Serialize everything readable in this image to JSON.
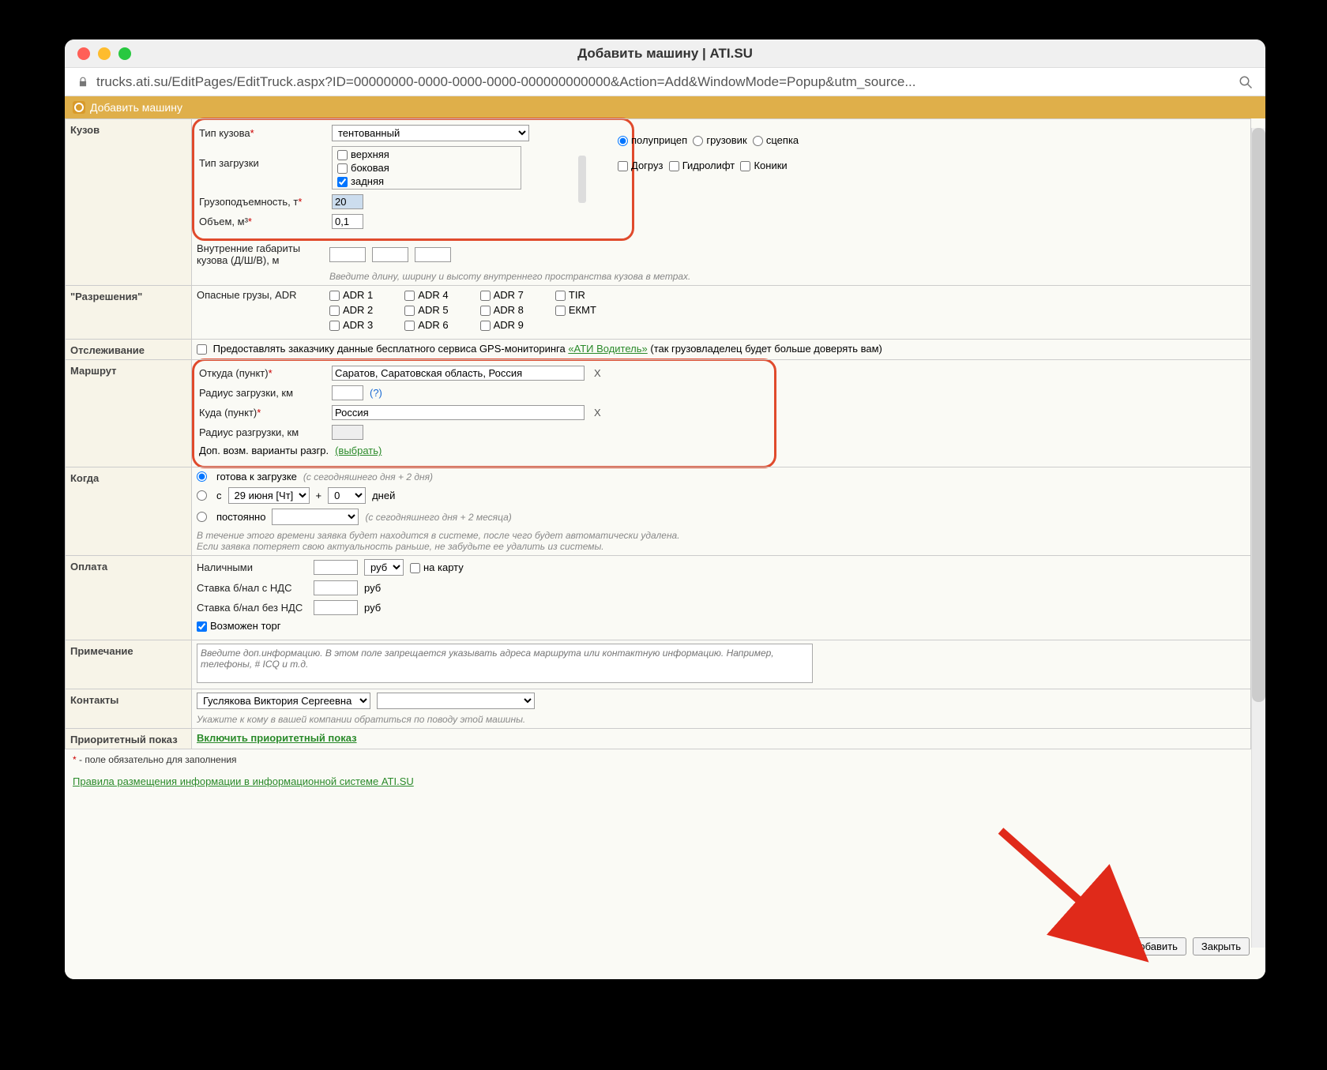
{
  "window": {
    "title": "Добавить машину | ATI.SU",
    "url": "trucks.ati.su/EditPages/EditTruck.aspx?ID=00000000-0000-0000-0000-000000000000&Action=Add&WindowMode=Popup&utm_source..."
  },
  "header": {
    "title": "Добавить машину"
  },
  "sections": {
    "body_label": "Кузов",
    "body_type_label": "Тип кузова",
    "body_type_value": "тентованный",
    "trailer_options": {
      "semi": "полуприцеп",
      "truck": "грузовик",
      "hitch": "сцепка"
    },
    "loading_label": "Тип загрузки",
    "loading_options": {
      "top": "верхняя",
      "side": "боковая",
      "rear": "задняя"
    },
    "extra_options": {
      "dogruz": "Догруз",
      "hydro": "Гидролифт",
      "koniki": "Коники"
    },
    "capacity_label": "Грузоподъемность, т",
    "capacity_value": "20",
    "volume_label": "Объем, м³",
    "volume_value": "0,1",
    "dims_label": "Внутренние габариты кузова (Д/Ш/В), м",
    "dims_hint": "Введите длину, ширину и высоту внутреннего пространства кузова в метрах.",
    "permits_label": "\"Разрешения\"",
    "adr_label": "Опасные грузы, ADR",
    "adr": [
      "ADR 1",
      "ADR 2",
      "ADR 3",
      "ADR 4",
      "ADR 5",
      "ADR 6",
      "ADR 7",
      "ADR 8",
      "ADR 9"
    ],
    "tir": "TIR",
    "ekmt": "ЕКМТ",
    "tracking_label": "Отслеживание",
    "tracking_text1": "Предоставлять заказчику данные бесплатного сервиса GPS-мониторинга ",
    "tracking_link": "«АТИ Водитель»",
    "tracking_text2": " (так грузовладелец будет больше доверять вам)",
    "route_label": "Маршрут",
    "from_label": "Откуда (пункт)",
    "from_value": "Саратов, Саратовская область, Россия",
    "load_radius_label": "Радиус загрузки, км",
    "to_label": "Куда (пункт)",
    "to_value": "Россия",
    "unload_radius_label": "Радиус разгрузки, км",
    "extra_unload_label": "Доп. возм. варианты разгр. ",
    "extra_unload_link": "(выбрать)",
    "when_label": "Когда",
    "when_ready": "готова к загрузке ",
    "when_ready_hint": "(с сегодняшнего дня + 2 дня)",
    "when_from": "с",
    "when_date": "29 июня [Чт]",
    "when_plus": "+",
    "when_days_value": "0",
    "when_days_label": "дней",
    "when_constant": "постоянно",
    "when_constant_hint": "(с сегодняшнего дня + 2 месяца)",
    "when_note": "В течение этого времени заявка будет находится в системе, после чего будет автоматически удалена.\nЕсли заявка потеряет свою актуальность раньше, не забудьте ее удалить из системы.",
    "payment_label": "Оплата",
    "cash_label": "Наличными",
    "currency": "руб",
    "on_card": "на карту",
    "rate_vat_label": "Ставка б/нал с НДС",
    "rate_novat_label": "Ставка б/нал без НДС",
    "bargain": "Возможен торг",
    "note_label": "Примечание",
    "note_placeholder": "Введите доп.информацию. В этом поле запрещается указывать адреса маршрута или контактную информацию. Например, телефоны, # ICQ и т.д.",
    "contacts_label": "Контакты",
    "contact_name": "Гуслякова Виктория Сергеевна",
    "contacts_hint": "Укажите к кому в вашей компании обратиться по поводу этой машины.",
    "priority_label": "Приоритетный показ",
    "priority_link": "Включить приоритетный показ"
  },
  "footer": {
    "required_note": " - поле обязательно для заполнения",
    "rules_link": "Правила размещения информации в информационной системе ATI.SU",
    "add_btn": "Добавить",
    "close_btn": "Закрыть"
  }
}
